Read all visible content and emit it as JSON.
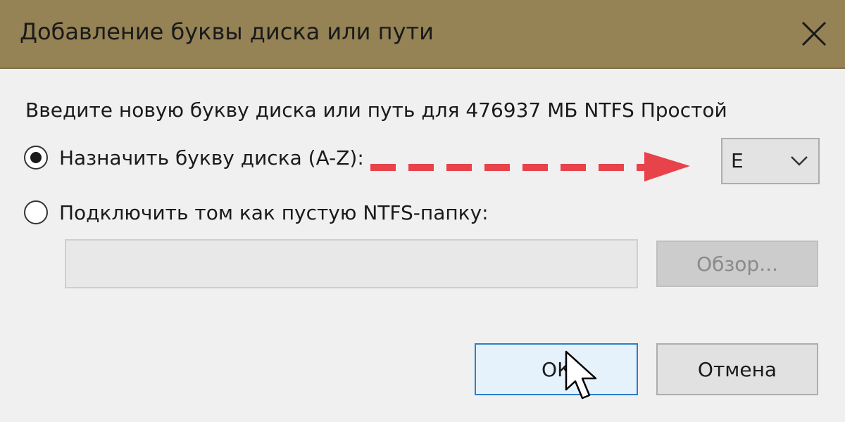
{
  "window": {
    "title": "Добавление буквы диска или пути",
    "close_icon": "close-icon"
  },
  "dialog": {
    "description": "Введите новую букву диска или путь для 476937 МБ NTFS Простой",
    "options": [
      {
        "label": "Назначить букву диска (A-Z):",
        "selected": true
      },
      {
        "label": "Подключить том как пустую NTFS-папку:",
        "selected": false
      }
    ],
    "drive_letter": {
      "value": "E",
      "icon": "chevron-down-icon"
    },
    "folder_path": {
      "value": "",
      "placeholder": "",
      "enabled": false
    },
    "browse_label": "Обзор...",
    "ok_label": "ОК",
    "cancel_label": "Отмена"
  },
  "colors": {
    "titlebar": "#958255",
    "dialog_bg": "#f0f0f0",
    "accent_border": "#2b7fcb",
    "annotation_arrow": "#e8424a"
  },
  "annotations": {
    "arrow_icon": "dashed-arrow-icon",
    "cursor_icon": "mouse-pointer-icon"
  }
}
